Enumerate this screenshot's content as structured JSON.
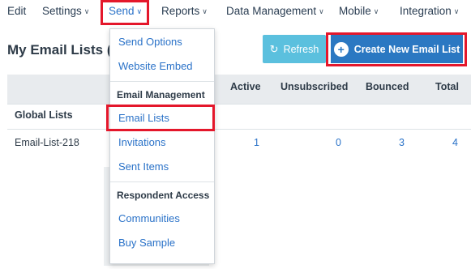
{
  "nav": {
    "edit": "Edit",
    "settings": "Settings",
    "send": "Send",
    "reports": "Reports",
    "data_management": "Data Management",
    "mobile": "Mobile",
    "integration": "Integration"
  },
  "page": {
    "title": "My Email Lists",
    "title_overflow": "(",
    "refresh_label": "Refresh",
    "create_label": "Create New Email List"
  },
  "table": {
    "headers": [
      "Active",
      "Unsubscribed",
      "Bounced",
      "Total"
    ],
    "group_label": "Global Lists",
    "rows": [
      {
        "name": "Email-List-218",
        "active": "1",
        "unsubscribed": "0",
        "bounced": "3",
        "total": "4"
      }
    ]
  },
  "send_menu": {
    "items": [
      {
        "type": "item",
        "label": "Send Options"
      },
      {
        "type": "item",
        "label": "Website Embed"
      },
      {
        "type": "header",
        "label": "Email Management"
      },
      {
        "type": "item",
        "label": "Email Lists"
      },
      {
        "type": "item",
        "label": "Invitations"
      },
      {
        "type": "item",
        "label": "Sent Items"
      },
      {
        "type": "header",
        "label": "Respondent Access"
      },
      {
        "type": "item",
        "label": "Communities"
      },
      {
        "type": "item",
        "label": "Buy Sample"
      }
    ]
  },
  "icons": {
    "chevron": "chevron-down-icon",
    "refresh": "refresh-icon",
    "plus": "plus-circle-icon"
  },
  "colors": {
    "highlight": "#e4172b",
    "link": "#2a72c8",
    "primary_button": "#2b78c2",
    "info_button": "#5bc0de"
  }
}
